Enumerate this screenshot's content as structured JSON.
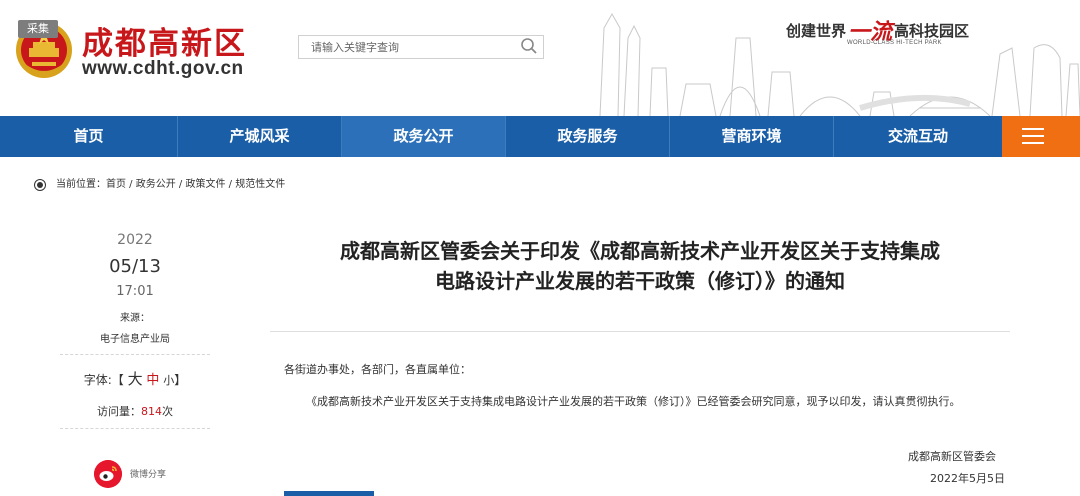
{
  "colors": {
    "brand_red": "#c8171b",
    "nav_blue": "#1a5ea8",
    "nav_active": "#2c70b9",
    "menu_orange": "#f06f13",
    "weibo_red": "#e6162d"
  },
  "header": {
    "collect_tag": "采集",
    "site_name": "成都高新区",
    "site_url": "www.cdht.gov.cn",
    "search": {
      "placeholder": "请输入关键字查询",
      "value": ""
    },
    "slogan": {
      "prefix": "创建世界",
      "highlight": "一流",
      "suffix": "高科技园区",
      "english": "WORLD-CLASS HI-TECH PARK"
    }
  },
  "nav": {
    "items": [
      {
        "label": "首页"
      },
      {
        "label": "产城风采"
      },
      {
        "label": "政务公开",
        "active": true
      },
      {
        "label": "政务服务"
      },
      {
        "label": "营商环境"
      },
      {
        "label": "交流互动"
      }
    ],
    "menu_icon": "hamburger-icon"
  },
  "breadcrumb": {
    "label": "当前位置：",
    "items": [
      "首页",
      "政务公开",
      "政策文件",
      "规范性文件"
    ],
    "separator": " / "
  },
  "meta": {
    "year": "2022",
    "date": "05/13",
    "time": "17:01",
    "source_label": "来源：",
    "source": "电子信息产业局",
    "font_label": "字体:【",
    "font_close": "】",
    "font_large": "大",
    "font_medium": "中",
    "font_small": "小",
    "visits_label": "访问量：",
    "visits_count": "814",
    "visits_unit": "次",
    "share_label": "微博分享",
    "share_icon": "weibo-icon"
  },
  "article": {
    "title_line1": "成都高新区管委会关于印发《成都高新技术产业开发区关于支持集成",
    "title_line2": "电路设计产业发展的若干政策（修订）》的通知",
    "salutation": "各街道办事处，各部门，各直属单位：",
    "paragraph": "《成都高新技术产业开发区关于支持集成电路设计产业发展的若干政策（修订）》已经管委会研究同意，现予以印发，请认真贯彻执行。",
    "sign_org": "成都高新区管委会",
    "sign_date": "2022年5月5日"
  }
}
